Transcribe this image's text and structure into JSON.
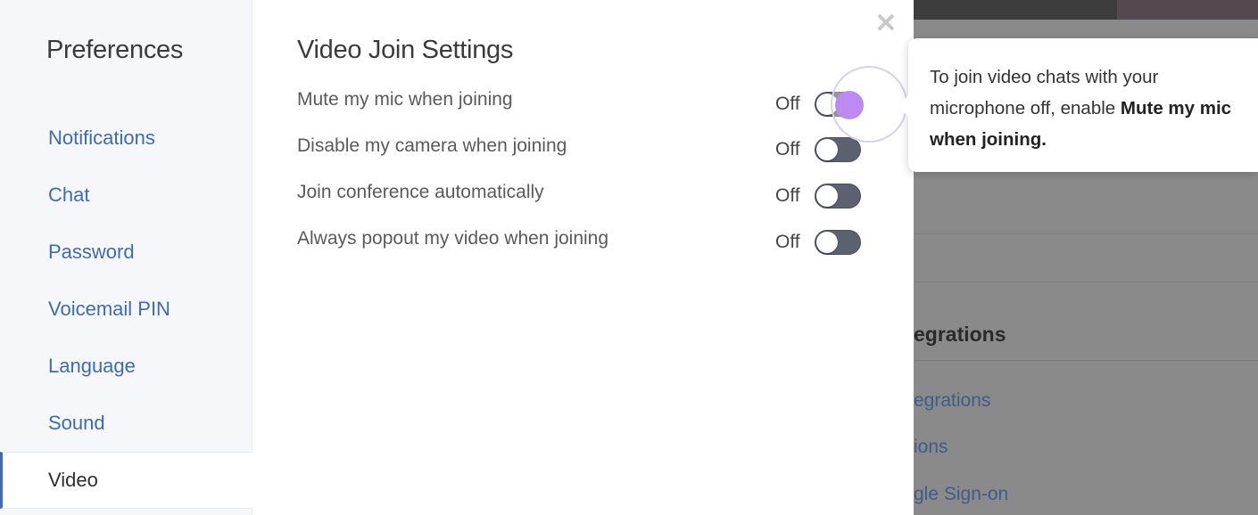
{
  "background_app": {
    "section_title": "egrations",
    "links": [
      "egrations",
      "ions",
      "gle Sign-on"
    ]
  },
  "sidebar": {
    "title": "Preferences",
    "items": [
      {
        "label": "Notifications"
      },
      {
        "label": "Chat"
      },
      {
        "label": "Password"
      },
      {
        "label": "Voicemail PIN"
      },
      {
        "label": "Language"
      },
      {
        "label": "Sound"
      },
      {
        "label": "Video",
        "active": true
      }
    ]
  },
  "main": {
    "section_title": "Video Join Settings",
    "settings": [
      {
        "label": "Mute my mic when joining",
        "state": "Off"
      },
      {
        "label": "Disable my camera when joining",
        "state": "Off"
      },
      {
        "label": "Join conference automatically",
        "state": "Off"
      },
      {
        "label": "Always popout my video when joining",
        "state": "Off"
      }
    ]
  },
  "close_icon": "close-icon",
  "tooltip": {
    "text_before": "To join video chats with your microphone off, enable ",
    "text_bold": "Mute my mic when joining."
  },
  "colors": {
    "link": "#3e6bb5",
    "highlight_purple": "#9b4bea",
    "toggle_off": "#5c6170"
  }
}
